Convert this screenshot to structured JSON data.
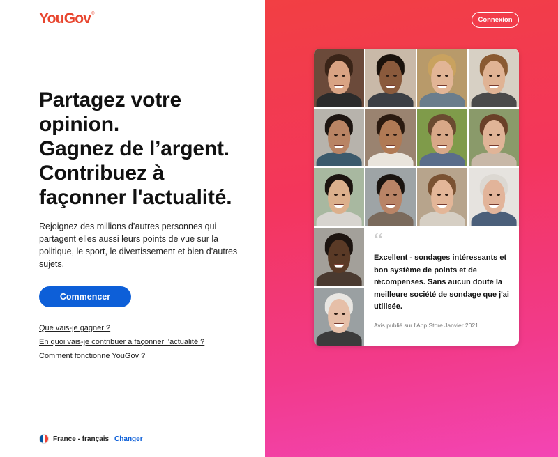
{
  "brand": {
    "logo_text": "YouGov",
    "logo_mark": "®"
  },
  "header": {
    "login_label": "Connexion"
  },
  "hero": {
    "headline_lines": [
      "Partagez votre",
      "opinion.",
      "Gagnez de l’argent.",
      "Contribuez à",
      "façonner l'actualité."
    ],
    "intro": "Rejoignez des millions d’autres personnes qui partagent elles aussi leurs points de vue sur la politique, le sport, le divertissement et bien d’autres sujets.",
    "cta_label": "Commencer"
  },
  "links": [
    "Que vais-je gagner ?",
    "En quoi vais-je contribuer à façonner l’actualité ?",
    "Comment fonctionne YouGov ?"
  ],
  "locale": {
    "current": "France - français",
    "change_label": "Changer"
  },
  "testimonial": {
    "quote_mark": "“",
    "text": "Excellent - sondages intéressants et bon système de points et de récompenses. Sans aucun doute la meilleure société de sondage que j'ai utilisée.",
    "source": "Avis publié sur l'App Store Janvier 2021"
  },
  "colors": {
    "brand_red": "#e8452e",
    "cta_blue": "#0d5fd8",
    "gradient_top": "#f23f43",
    "gradient_bottom": "#f345b4"
  },
  "faces": [
    {
      "bg": "#6b4a3a",
      "skin": "#d9a383",
      "hair": "#3a2418",
      "shirt": "#2b2b2b"
    },
    {
      "bg": "#c9b9a8",
      "skin": "#8a5a3c",
      "hair": "#1a120c",
      "shirt": "#3c3f45"
    },
    {
      "bg": "#b89a6a",
      "skin": "#e2b596",
      "hair": "#c9a25f",
      "shirt": "#6a7d8c"
    },
    {
      "bg": "#d7d0c4",
      "skin": "#e0b394",
      "hair": "#8a5a32",
      "shirt": "#4a4a4a"
    },
    {
      "bg": "#b7b3ac",
      "skin": "#b98464",
      "hair": "#1e1612",
      "shirt": "#3b5a6c"
    },
    {
      "bg": "#9a8370",
      "skin": "#b07a55",
      "hair": "#2a1a10",
      "shirt": "#e9e4dc"
    },
    {
      "bg": "#7f9b4a",
      "skin": "#d8a888",
      "hair": "#6a4a30",
      "shirt": "#5a6d8a"
    },
    {
      "bg": "#8a9a6a",
      "skin": "#e0b497",
      "hair": "#6a4028",
      "shirt": "#c8b8a8"
    },
    {
      "bg": "#a8b8a0",
      "skin": "#dcb08c",
      "hair": "#1c1410",
      "shirt": "#d7d4cf"
    },
    {
      "bg": "#9ea4a6",
      "skin": "#b98466",
      "hair": "#1a1410",
      "shirt": "#7a6a5c"
    },
    {
      "bg": "#b7a48c",
      "skin": "#e3b698",
      "hair": "#7a5232",
      "shirt": "#d6cfc4"
    },
    {
      "bg": "#e6e3df",
      "skin": "#e2b49a",
      "hair": "#dcd8d2",
      "shirt": "#4b5f7a"
    }
  ],
  "side_faces": [
    {
      "bg": "#a3a09a",
      "skin": "#5a3a26",
      "hair": "#1c1410",
      "shirt": "#4a3a30"
    },
    {
      "bg": "#9aa0a2",
      "skin": "#e6bfa8",
      "hair": "#e8e6e2",
      "shirt": "#3b3b3b"
    }
  ]
}
